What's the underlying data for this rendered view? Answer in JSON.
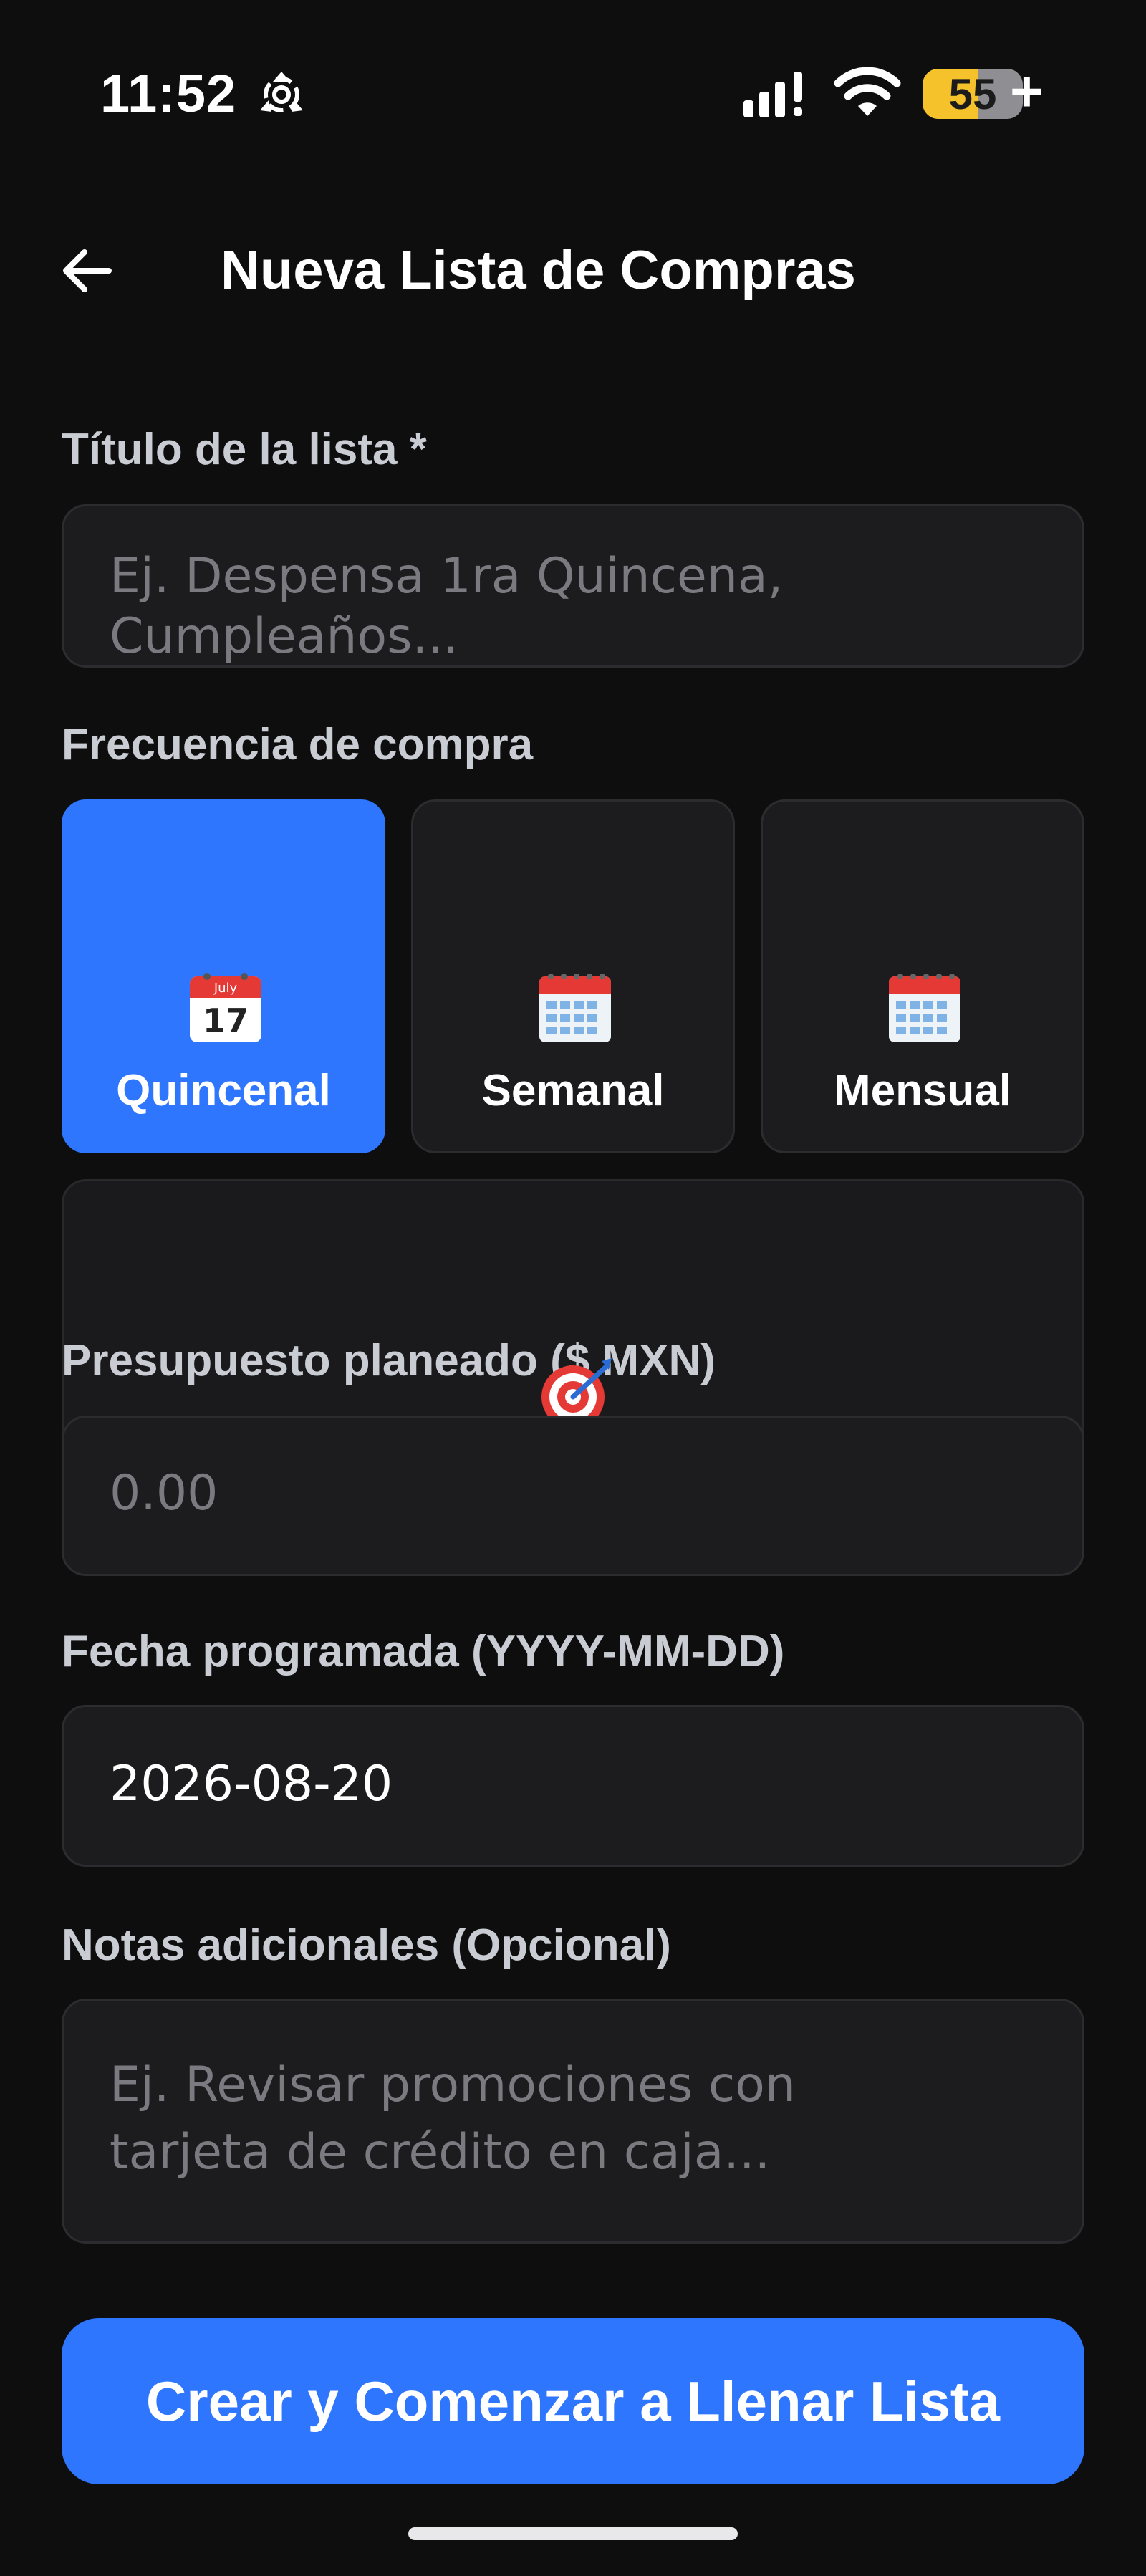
{
  "status_bar": {
    "time": "11:52",
    "battery_level": "55",
    "battery_fraction": 0.55,
    "battery_color": "#f6c22b",
    "icons": [
      "hotspot-icon",
      "signal-icon",
      "wifi-icon",
      "battery-icon"
    ]
  },
  "header": {
    "title": "Nueva Lista de Compras",
    "back_icon": "arrow-left-icon"
  },
  "form": {
    "title_label": "Título de la lista *",
    "title_placeholder": "Ej. Despensa 1ra Quincena, Cumpleaños...",
    "frequency_label": "Frecuencia de compra",
    "frequency_options": [
      {
        "label": "Quincenal",
        "icon": "calendar-date-icon",
        "selected": true
      },
      {
        "label": "Semanal",
        "icon": "calendar-icon",
        "selected": false
      },
      {
        "label": "Mensual",
        "icon": "calendar-icon",
        "selected": false
      }
    ],
    "budget_label": "Presupuesto planeado ($ MXN)",
    "budget_placeholder": "0.00",
    "date_label": "Fecha programada (YYYY-MM-DD)",
    "date_value": "2026-08-20",
    "notes_label": "Notas adicionales (Opcional)",
    "notes_placeholder_line1": "Ej. Revisar promociones con",
    "notes_placeholder_line2": "tarjeta de crédito en caja...",
    "submit_label": "Crear y Comenzar a Llenar Lista"
  },
  "colors": {
    "background": "#0e0e0f",
    "accent": "#2f76ff",
    "field": "#1c1c1e",
    "label": "#c9cdd3",
    "placeholder": "#7a7a80"
  }
}
